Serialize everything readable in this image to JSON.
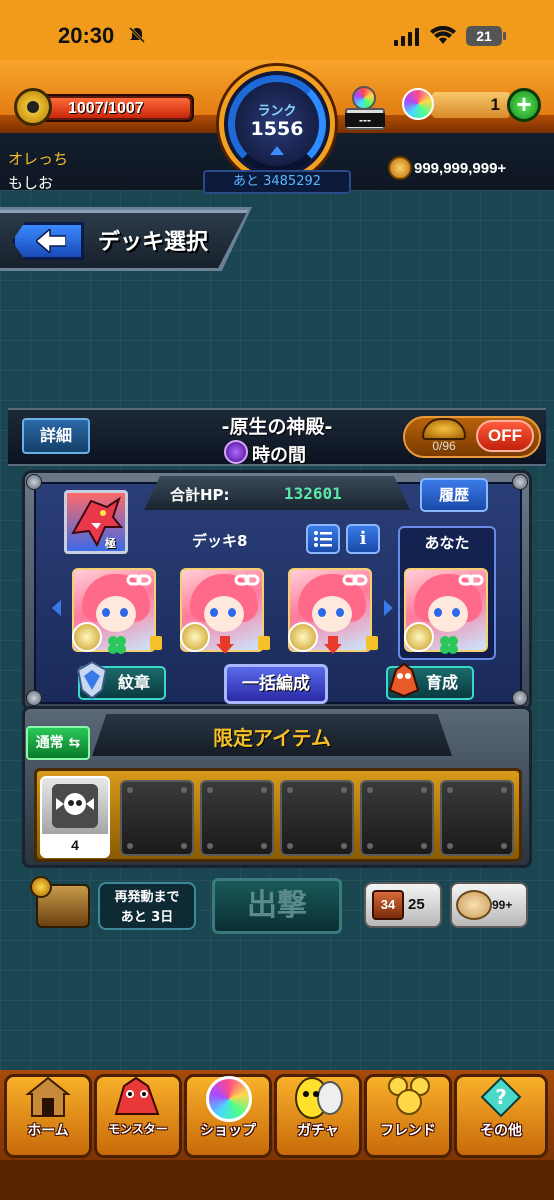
{
  "status_bar": {
    "time": "20:30",
    "battery": "21"
  },
  "header": {
    "stamina": "1007/1007",
    "stamina_fraction": 1.0,
    "rank_label": "ランク",
    "rank_value": "1556",
    "exp_to_next": "あと 3485292",
    "capsule_text": "---",
    "orb_count": "1",
    "player_title": "オレっち",
    "player_name": "もしお",
    "coins": "999,999,999+"
  },
  "page": {
    "title": "デッキ選択"
  },
  "quest": {
    "detail_label": "詳細",
    "name": "-原生の神殿-",
    "sub": "時の間",
    "auto_count": "0/96",
    "auto_state": "OFF"
  },
  "deck": {
    "hp_label": "合計HP:",
    "hp_value": "132601",
    "history_label": "履歴",
    "deck_name": "デッキ8",
    "info_label": "i",
    "you_label": "あなた",
    "emblem_label": "紋章",
    "bulk_label": "一括編成",
    "train_label": "育成",
    "leader_tag": "極"
  },
  "items": {
    "mode_label": "通常",
    "title": "限定アイテム",
    "filled_item_count": "4"
  },
  "actions": {
    "reactivate_line1": "再発動まで",
    "reactivate_line2": "あと 3日",
    "sortie_label": "出撃",
    "dice_count": "25",
    "dice_face": "34",
    "cookie_count": "99+"
  },
  "nav": {
    "items": [
      {
        "label": "ホーム",
        "icon": "home-icon"
      },
      {
        "label": "モンスター",
        "icon": "monster-icon"
      },
      {
        "label": "ショップ",
        "icon": "shop-orb-icon"
      },
      {
        "label": "ガチャ",
        "icon": "gacha-icon"
      },
      {
        "label": "フレンド",
        "icon": "friend-icon"
      },
      {
        "label": "その他",
        "icon": "other-icon"
      }
    ]
  }
}
